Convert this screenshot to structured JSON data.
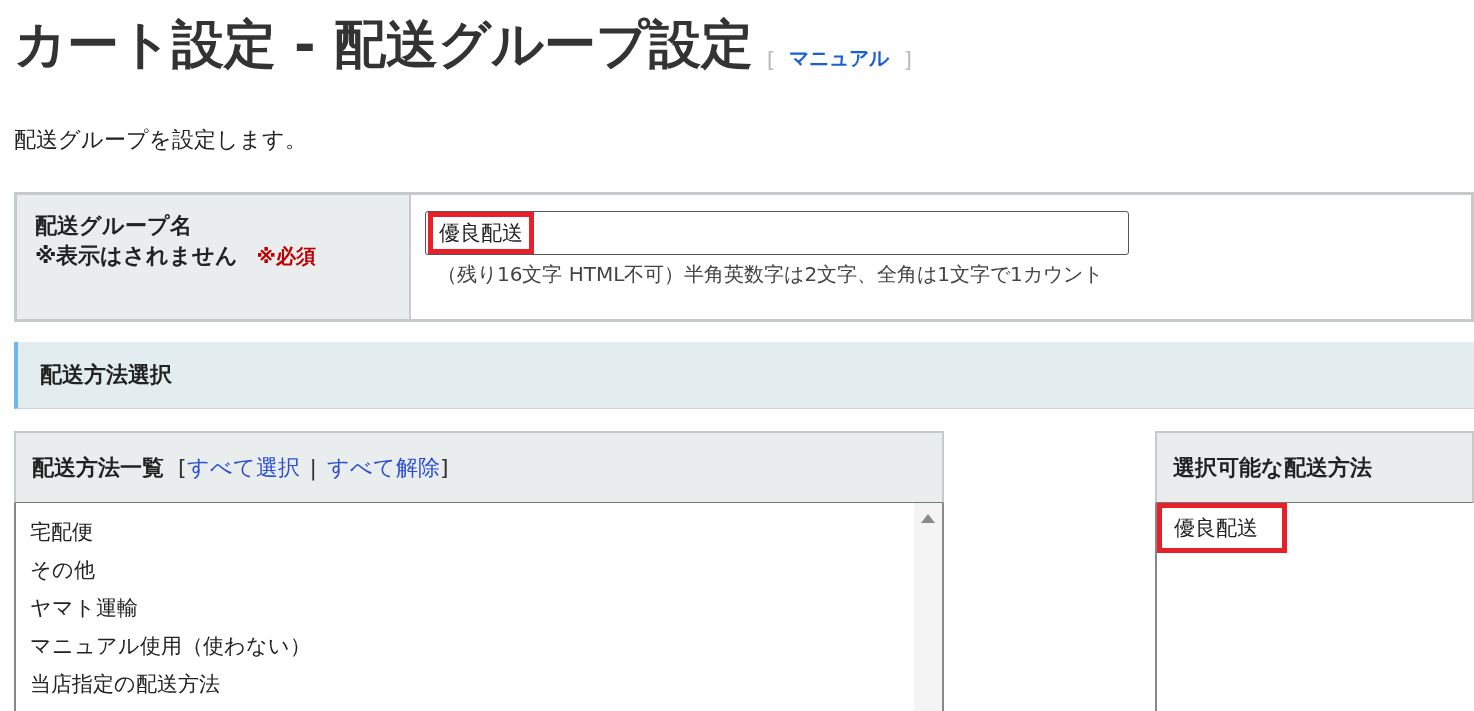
{
  "page": {
    "title": "カート設定 - 配送グループ設定",
    "bracket_open": "[",
    "manual_link": "マニュアル",
    "bracket_close": "]",
    "description": "配送グループを設定します。"
  },
  "form": {
    "label": "配送グループ名",
    "note": "※表示はされません",
    "required": "※必須",
    "value": "優良配送",
    "value_highlighted": true,
    "hint": "（残り16文字 HTML不可）半角英数字は2文字、全角は1文字で1カウント"
  },
  "section": {
    "title": "配送方法選択"
  },
  "method_list": {
    "title": "配送方法一覧",
    "bracket_open": "[",
    "select_all": "すべて選択",
    "separator": "|",
    "deselect_all": "すべて解除",
    "bracket_close": "]",
    "items": [
      {
        "label": "宅配便",
        "selected": false
      },
      {
        "label": "その他",
        "selected": false
      },
      {
        "label": "ヤマト運輸",
        "selected": false
      },
      {
        "label": "マニュアル使用（使わない）",
        "selected": false
      },
      {
        "label": "当店指定の配送方法",
        "selected": false
      }
    ]
  },
  "available": {
    "title": "選択可能な配送方法",
    "items": [
      {
        "label": "優良配送",
        "highlighted": true
      }
    ]
  }
}
